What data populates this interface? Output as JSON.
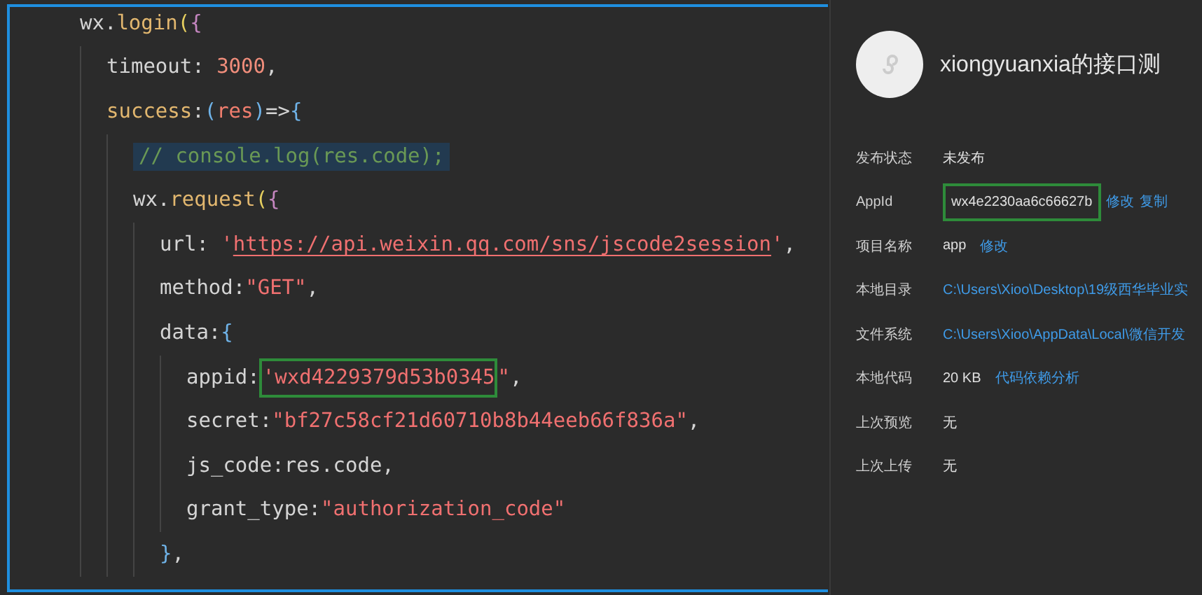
{
  "editor": {
    "lines": [
      {
        "tokens": [
          {
            "kind": "plain",
            "text": "wx."
          },
          {
            "kind": "func",
            "text": "login"
          },
          {
            "kind": "paren",
            "text": "("
          },
          {
            "kind": "brace",
            "text": "{"
          }
        ],
        "children": [
          {
            "tokens": [
              {
                "kind": "plain",
                "text": "timeout: "
              },
              {
                "kind": "number",
                "text": "3000"
              },
              {
                "kind": "plain",
                "text": ","
              }
            ]
          },
          {
            "tokens": [
              {
                "kind": "func",
                "text": "success"
              },
              {
                "kind": "plain",
                "text": ":"
              },
              {
                "kind": "paren2",
                "text": "("
              },
              {
                "kind": "param",
                "text": "res"
              },
              {
                "kind": "paren2",
                "text": ")"
              },
              {
                "kind": "plain",
                "text": "=>"
              },
              {
                "kind": "paren2",
                "text": "{"
              }
            ],
            "children": [
              {
                "highlighted": true,
                "tokens": [
                  {
                    "kind": "comment",
                    "text": "// console.log(res.code);"
                  }
                ]
              },
              {
                "tokens": [
                  {
                    "kind": "plain",
                    "text": "wx."
                  },
                  {
                    "kind": "func",
                    "text": "request"
                  },
                  {
                    "kind": "paren",
                    "text": "("
                  },
                  {
                    "kind": "brace",
                    "text": "{"
                  }
                ],
                "children": [
                  {
                    "tokens": [
                      {
                        "kind": "plain",
                        "text": "url: "
                      },
                      {
                        "kind": "string",
                        "text": "'"
                      },
                      {
                        "kind": "link",
                        "text": "https://api.weixin.qq.com/sns/jscode2session"
                      },
                      {
                        "kind": "string",
                        "text": "'"
                      },
                      {
                        "kind": "plain",
                        "text": ","
                      }
                    ]
                  },
                  {
                    "tokens": [
                      {
                        "kind": "plain",
                        "text": "method:"
                      },
                      {
                        "kind": "string",
                        "text": "\"GET\""
                      },
                      {
                        "kind": "plain",
                        "text": ","
                      }
                    ]
                  },
                  {
                    "tokens": [
                      {
                        "kind": "plain",
                        "text": "data:"
                      },
                      {
                        "kind": "paren2",
                        "text": "{"
                      }
                    ],
                    "children": [
                      {
                        "tokens": [
                          {
                            "kind": "plain",
                            "text": "appid:"
                          },
                          {
                            "kind": "string",
                            "text": "'wxd4229379d53b0345",
                            "boxed": true
                          },
                          {
                            "kind": "string",
                            "text": "\""
                          },
                          {
                            "kind": "plain",
                            "text": ","
                          }
                        ]
                      },
                      {
                        "tokens": [
                          {
                            "kind": "plain",
                            "text": "secret:"
                          },
                          {
                            "kind": "string",
                            "text": "\"bf27c58cf21d60710b8b44eeb66f836a\""
                          },
                          {
                            "kind": "plain",
                            "text": ","
                          }
                        ]
                      },
                      {
                        "tokens": [
                          {
                            "kind": "plain",
                            "text": "js_code:res.code,"
                          }
                        ]
                      },
                      {
                        "tokens": [
                          {
                            "kind": "plain",
                            "text": "grant_type:"
                          },
                          {
                            "kind": "string",
                            "text": "\"authorization_code\""
                          }
                        ]
                      }
                    ]
                  },
                  {
                    "tokens": [
                      {
                        "kind": "paren2",
                        "text": "}"
                      },
                      {
                        "kind": "plain",
                        "text": ","
                      }
                    ]
                  }
                ]
              }
            ]
          }
        ]
      }
    ]
  },
  "panel": {
    "title": "xiongyuanxia的接口测",
    "rows": [
      {
        "label": "发布状态",
        "value": "未发布"
      },
      {
        "label": "AppId",
        "value": "wx4e2230aa6c66627b",
        "boxed": true,
        "links": [
          "修改",
          "复制"
        ]
      },
      {
        "label": "项目名称",
        "value": "app",
        "links": [
          "修改"
        ]
      },
      {
        "label": "本地目录",
        "value": "C:\\Users\\Xioo\\Desktop\\19级西华毕业实",
        "value_is_link": true
      },
      {
        "label": "文件系统",
        "value": "C:\\Users\\Xioo\\AppData\\Local\\微信开发",
        "value_is_link": true
      },
      {
        "label": "本地代码",
        "value": "20 KB",
        "links": [
          "代码依赖分析"
        ]
      },
      {
        "label": "上次预览",
        "value": "无"
      },
      {
        "label": "上次上传",
        "value": "无"
      }
    ]
  }
}
